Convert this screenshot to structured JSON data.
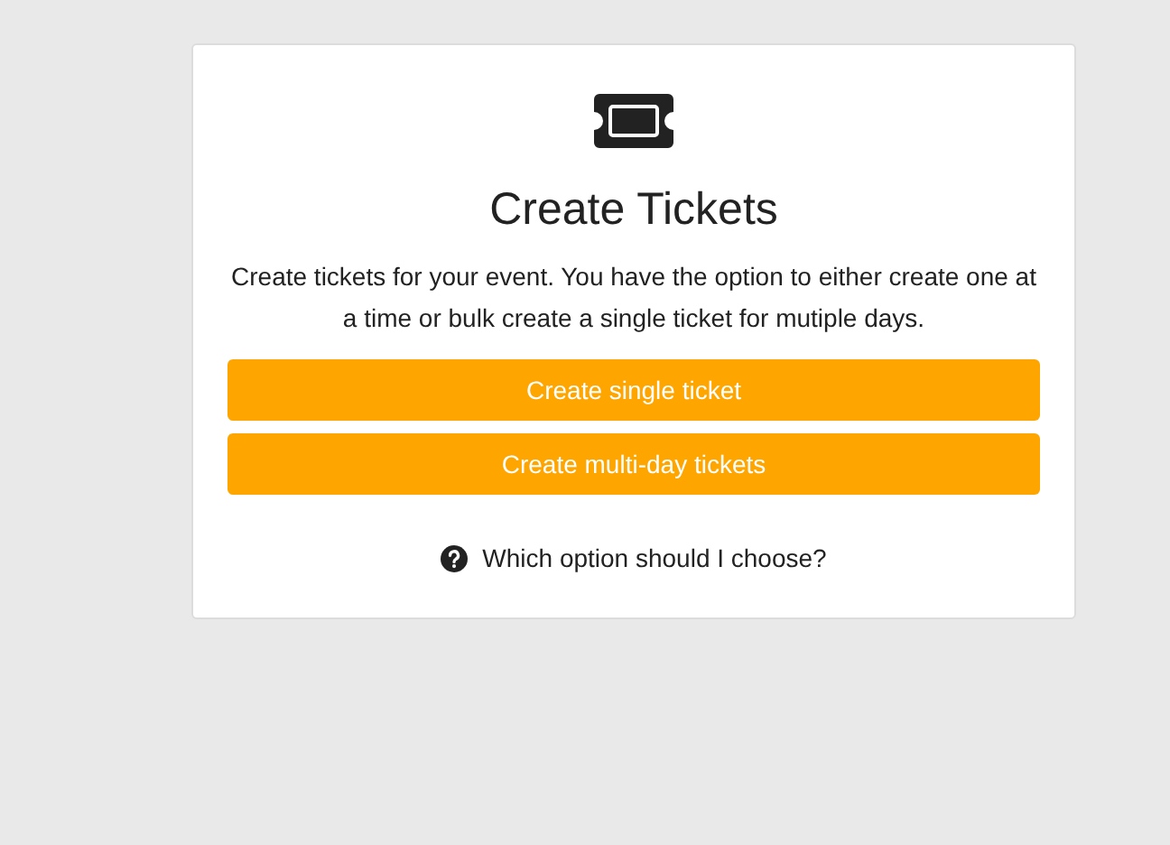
{
  "card": {
    "title": "Create Tickets",
    "description": "Create tickets for your event. You have the option to either create one at a time or bulk create a single ticket for mutiple days.",
    "buttons": [
      "Create single ticket",
      "Create multi-day tickets"
    ],
    "help_link": "Which option should I choose?"
  }
}
